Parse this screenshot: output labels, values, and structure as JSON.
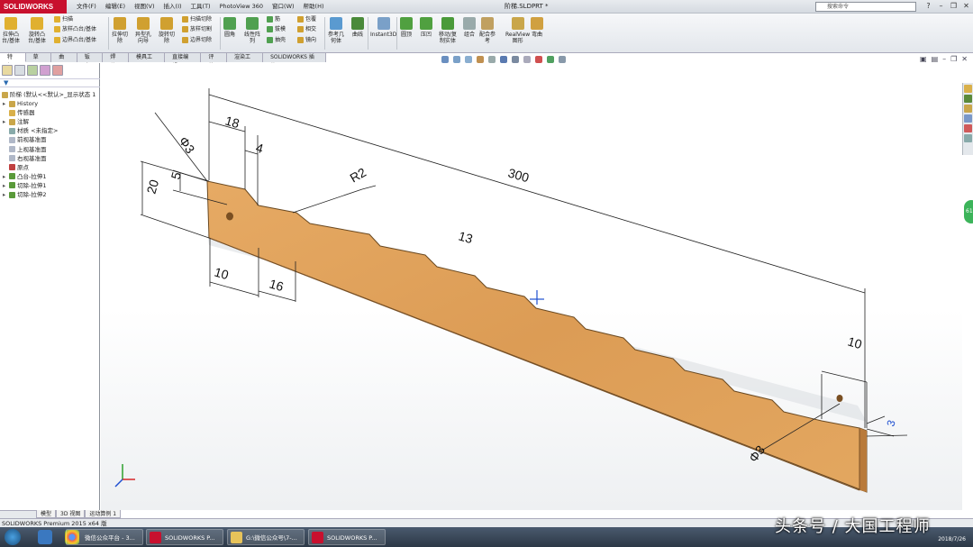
{
  "app": {
    "brand": "SOLIDWORKS",
    "doc_title": "阶梯.SLDPRT *"
  },
  "menu": [
    "文件(F)",
    "编辑(E)",
    "视图(V)",
    "插入(I)",
    "工具(T)",
    "PhotoView 360",
    "窗口(W)",
    "帮助(H)"
  ],
  "search": {
    "placeholder": "搜索命令"
  },
  "ribbon": {
    "big": [
      {
        "label": "拉伸凸\n台/基体",
        "icon": "extrude-boss-icon"
      },
      {
        "label": "旋转凸\n台/基体",
        "icon": "revolve-boss-icon"
      },
      {
        "label": "拉伸切\n除",
        "icon": "extrude-cut-icon"
      },
      {
        "label": "异型孔\n向导",
        "icon": "hole-wizard-icon"
      },
      {
        "label": "旋转切\n除",
        "icon": "revolve-cut-icon"
      },
      {
        "label": "圆角",
        "icon": "fillet-icon"
      },
      {
        "label": "线性阵\n列",
        "icon": "linear-pattern-icon"
      },
      {
        "label": "参考几\n何体",
        "icon": "reference-geometry-icon"
      },
      {
        "label": "曲线",
        "icon": "curves-icon"
      },
      {
        "label": "Instant3D",
        "icon": "instant3d-icon"
      },
      {
        "label": "圆顶",
        "icon": "dome-icon"
      },
      {
        "label": "压凹",
        "icon": "indent-icon"
      },
      {
        "label": "移动/复\n制实体",
        "icon": "move-copy-icon"
      },
      {
        "label": "组合",
        "icon": "combine-icon"
      },
      {
        "label": "配合参\n考",
        "icon": "mate-reference-icon"
      },
      {
        "label": "RealView\n图形",
        "icon": "realview-icon"
      },
      {
        "label": "弯曲",
        "icon": "flex-icon"
      }
    ],
    "small": [
      {
        "label": "扫描",
        "icon": "sweep-icon"
      },
      {
        "label": "放样凸台/基体",
        "icon": "loft-icon"
      },
      {
        "label": "边界凸台/基体",
        "icon": "boundary-icon"
      },
      {
        "label": "扫描切除",
        "icon": "swept-cut-icon"
      },
      {
        "label": "放样切割",
        "icon": "lofted-cut-icon"
      },
      {
        "label": "边界切除",
        "icon": "boundary-cut-icon"
      },
      {
        "label": "筋",
        "icon": "rib-icon"
      },
      {
        "label": "拔模",
        "icon": "draft-icon"
      },
      {
        "label": "抽壳",
        "icon": "shell-icon"
      },
      {
        "label": "包覆",
        "icon": "wrap-icon"
      },
      {
        "label": "相交",
        "icon": "intersect-icon"
      },
      {
        "label": "镜向",
        "icon": "mirror-icon"
      }
    ]
  },
  "tabs": [
    "特征",
    "草图",
    "曲面",
    "钣金",
    "焊件",
    "模具工具",
    "直接编辑",
    "评估",
    "渲染工具",
    "SOLIDWORKS 插件"
  ],
  "tree": {
    "root": "阶梯  (默认<<默认>_显示状态 1",
    "items": [
      {
        "label": "History",
        "icon": "history-icon"
      },
      {
        "label": "传感器",
        "icon": "sensor-icon"
      },
      {
        "label": "注解",
        "icon": "annotation-icon"
      },
      {
        "label": "材质 <未指定>",
        "icon": "material-icon"
      },
      {
        "label": "前视基准面",
        "icon": "plane-icon"
      },
      {
        "label": "上视基准面",
        "icon": "plane-icon"
      },
      {
        "label": "右视基准面",
        "icon": "plane-icon"
      },
      {
        "label": "原点",
        "icon": "origin-icon"
      },
      {
        "label": "凸台-拉伸1",
        "icon": "feature-icon"
      },
      {
        "label": "切除-拉伸1",
        "icon": "feature-icon"
      },
      {
        "label": "切除-拉伸2",
        "icon": "feature-icon"
      }
    ]
  },
  "dims": {
    "d18": "18",
    "d4": "4",
    "d3a": "3",
    "d5": "5",
    "d20": "20",
    "r2": "R2",
    "d300": "300",
    "d13": "13",
    "d10a": "10",
    "d16": "16",
    "d10b": "10",
    "d3b": "3",
    "d3c": "3"
  },
  "bottom_tabs": [
    "模型",
    "3D 视图",
    "运动算例 1"
  ],
  "status": "SOLIDWORKS Premium 2015 x64 版",
  "taskbar": {
    "tasks": [
      "微信公众平台 - 3...",
      "SOLIDWORKS P...",
      "G:\\微信公众号\\7-...",
      "SOLIDWORKS P..."
    ],
    "date": "2018/7/26"
  },
  "watermark": "头条号 / 大国工程师",
  "colors": {
    "wood": "#e0a25a",
    "brand": "#c8102e"
  }
}
